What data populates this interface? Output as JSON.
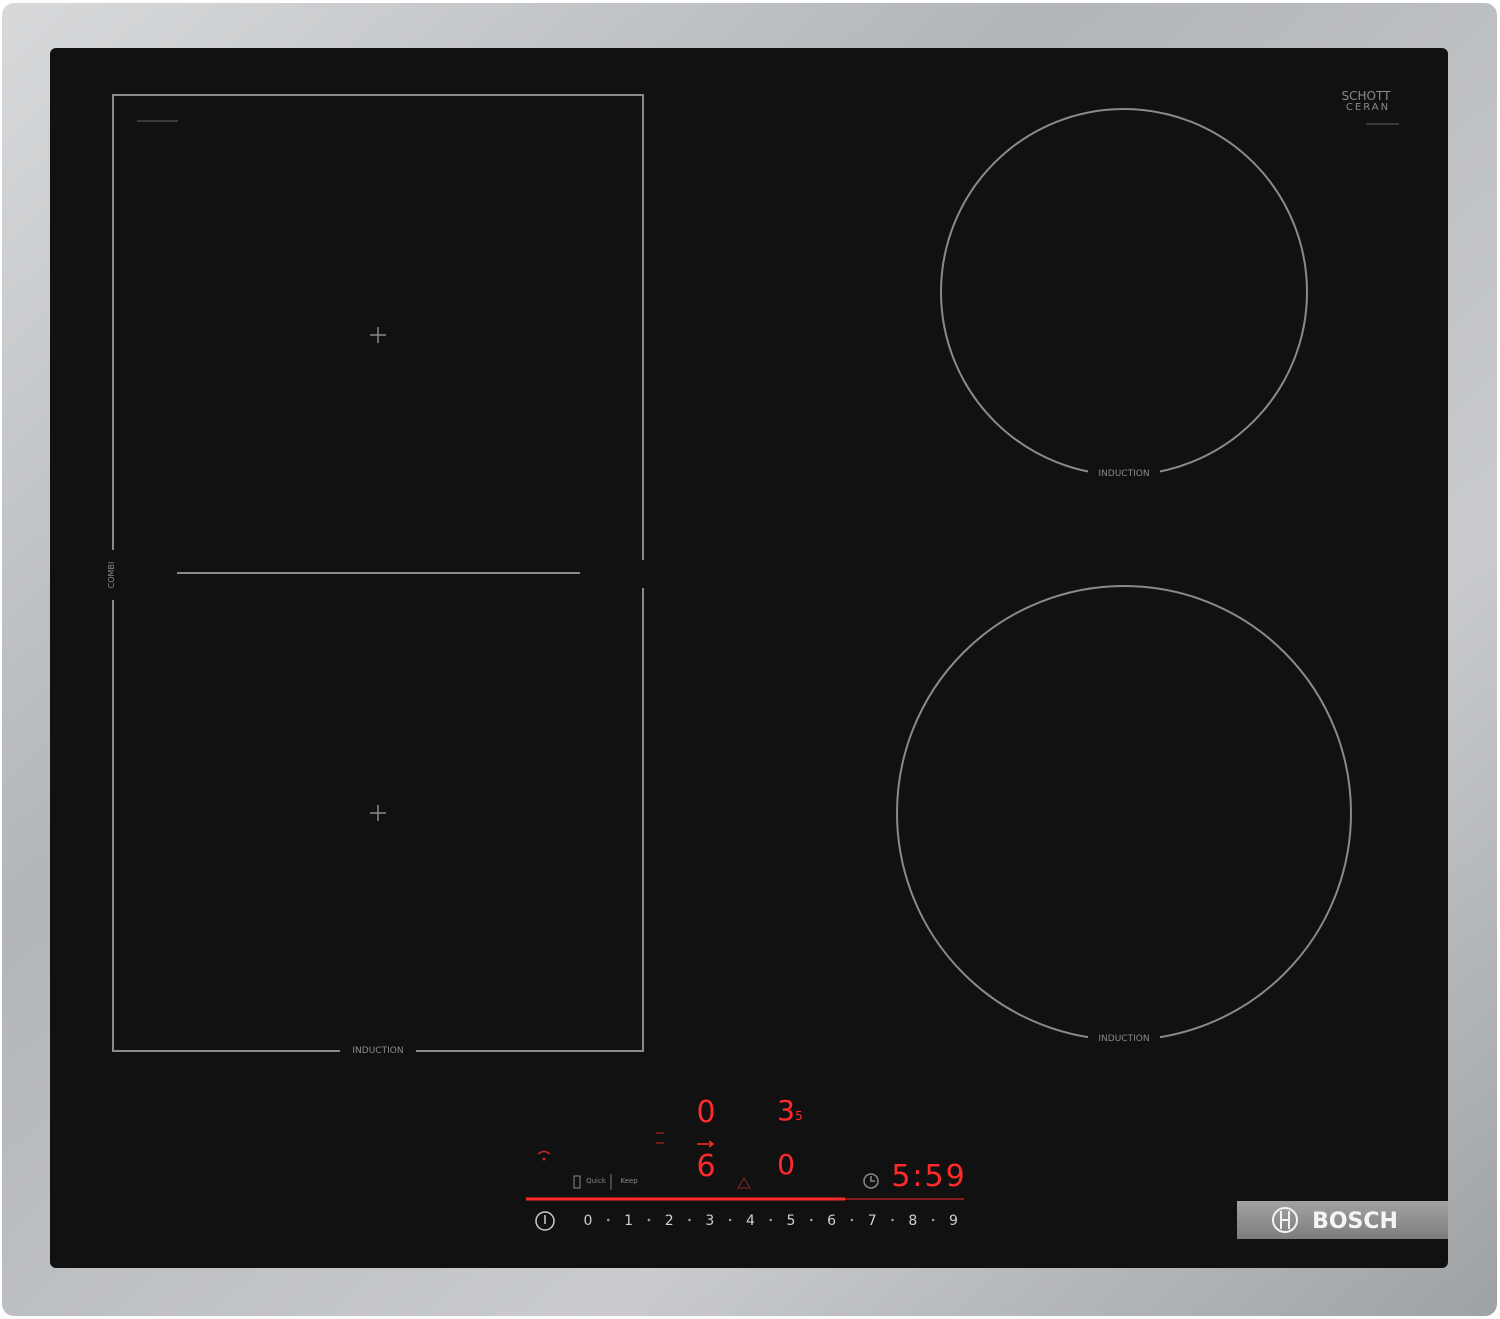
{
  "brand": {
    "name": "BOSCH",
    "glass_maker_line1": "SCHOTT",
    "glass_maker_line2": "CERAN"
  },
  "zones": {
    "flex_zone_label": "INDUCTION",
    "flex_side_label": "COMBI",
    "top_right_label": "INDUCTION",
    "bottom_right_label": "INDUCTION"
  },
  "control_panel": {
    "display_top_left": "0",
    "display_top_right": "3",
    "display_top_right_sub": "5",
    "display_mid_left": "6",
    "display_mid_right": "0",
    "timer": "5:59",
    "func_a": "Quick",
    "func_b": "Keep",
    "scale": [
      "0",
      "1",
      "2",
      "3",
      "4",
      "5",
      "6",
      "7",
      "8",
      "9"
    ]
  },
  "colors": {
    "frame": "#b9bcbf",
    "glass": "#111111",
    "zone_line": "#8a8a8a",
    "led_red": "#ff2a2a",
    "badge_bg": "#8f8f8f"
  }
}
